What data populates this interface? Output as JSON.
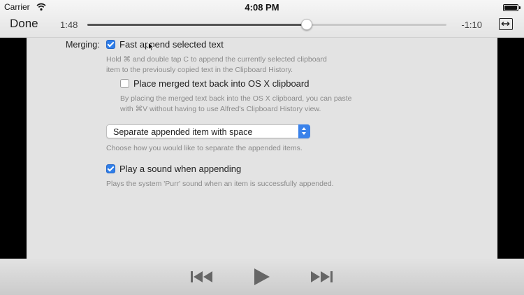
{
  "status_bar": {
    "carrier": "Carrier",
    "time": "4:08 PM"
  },
  "player": {
    "done_label": "Done",
    "elapsed": "1:48",
    "remaining": "-1:10",
    "progress": 0.61,
    "icons": {
      "wifi": "wifi-icon",
      "battery": "battery-icon",
      "aspect": "aspect-ratio-icon",
      "rewind": "skip-back-icon",
      "play": "play-icon",
      "forward": "skip-forward-icon"
    }
  },
  "settings": {
    "section_label": "Merging:",
    "fast_append": {
      "label": "Fast append selected text",
      "checked": true,
      "description_line1": "Hold ⌘ and double tap C to append the currently selected clipboard",
      "description_line2": "item to the previously copied text in the Clipboard History."
    },
    "place_back": {
      "label": "Place merged text back into OS X clipboard",
      "checked": false,
      "description_line1": "By placing the merged text back into the OS X clipboard, you can paste",
      "description_line2": "with ⌘V without having to use Alfred's Clipboard History view."
    },
    "separator_select": {
      "value": "Separate appended item with space",
      "description": "Choose how you would like to separate the appended items."
    },
    "play_sound": {
      "label": "Play a sound when appending",
      "checked": true,
      "description": "Plays the system 'Purr' sound when an item is successfully appended."
    }
  },
  "colors": {
    "accent": "#2f7ee9",
    "pane_bg": "#e3e3e3"
  }
}
